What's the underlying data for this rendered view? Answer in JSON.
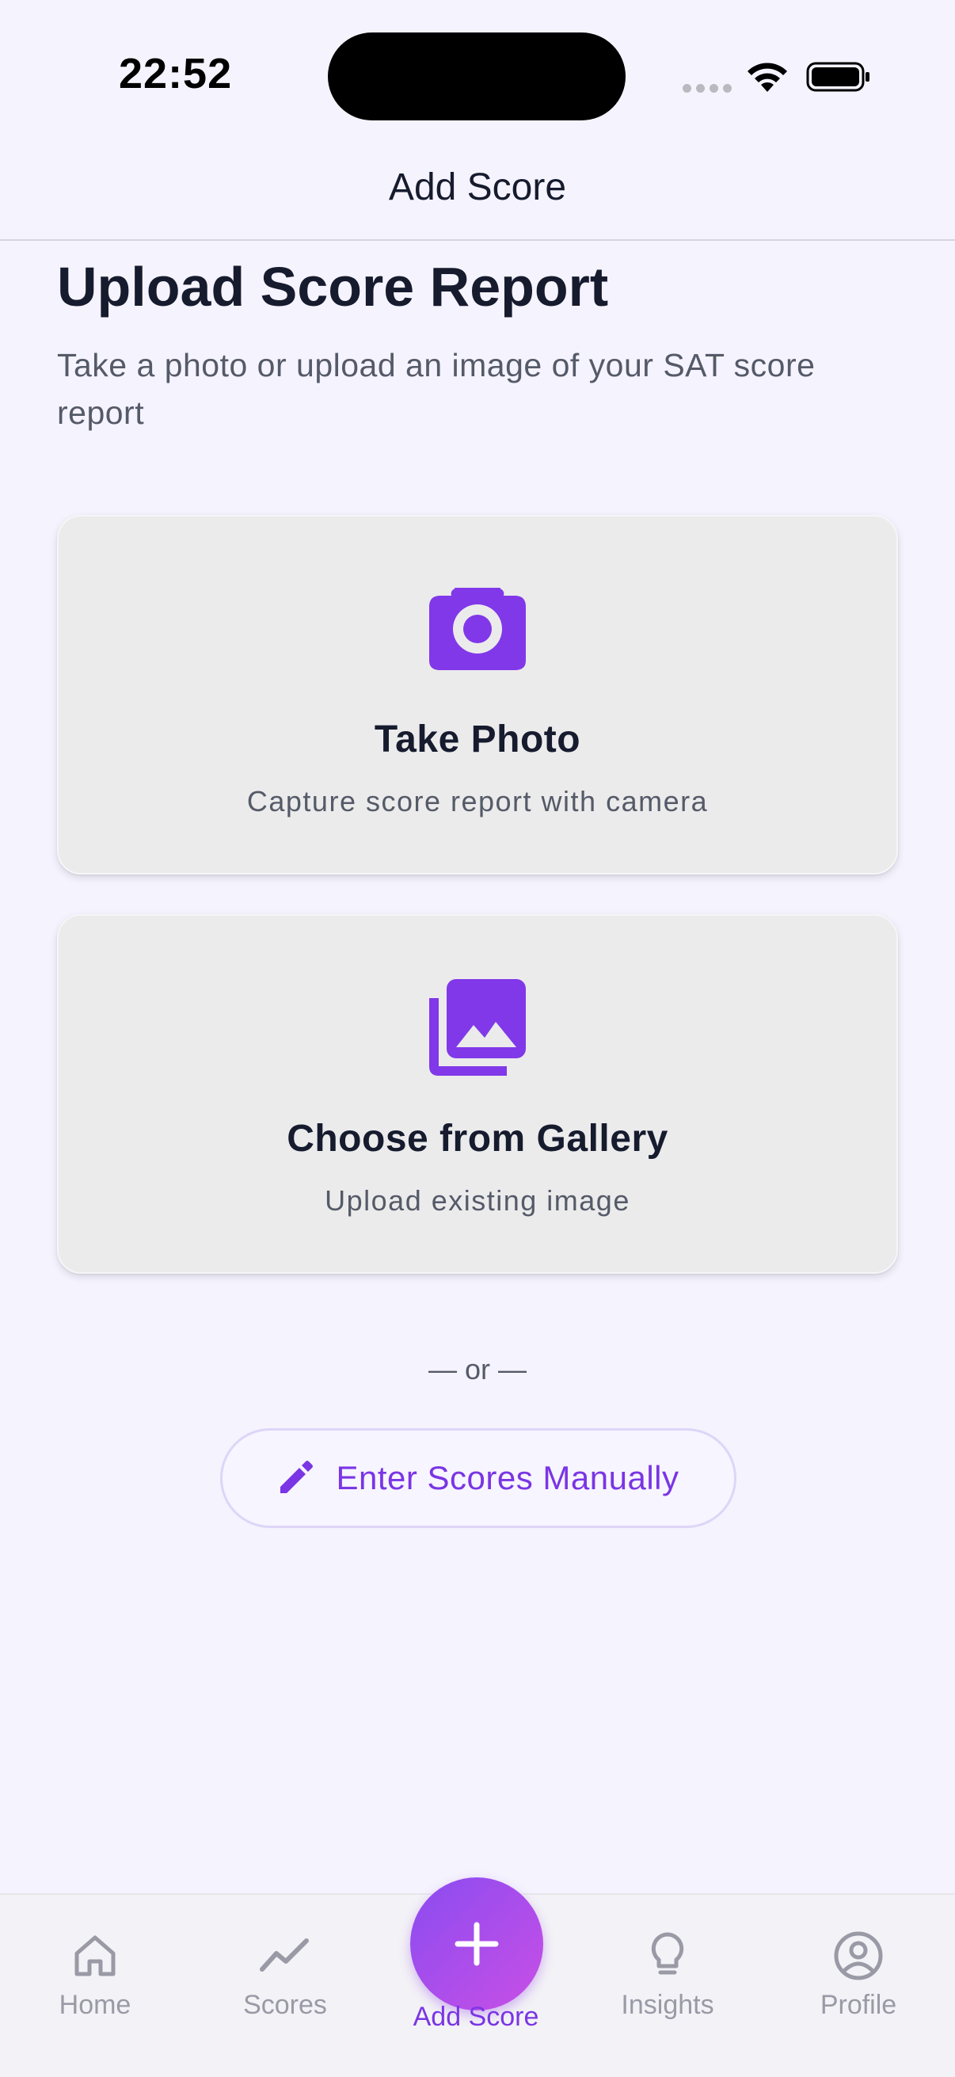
{
  "status_bar": {
    "time": "22:52",
    "icons": [
      "signal-dots-icon",
      "wifi-icon",
      "battery-icon"
    ]
  },
  "nav": {
    "title": "Add Score"
  },
  "main": {
    "heading": "Upload Score Report",
    "subtitle": "Take a photo or upload an image of your SAT score report",
    "options": [
      {
        "icon": "camera-icon",
        "title": "Take Photo",
        "subtitle": "Capture score report with camera"
      },
      {
        "icon": "gallery-icon",
        "title": "Choose from Gallery",
        "subtitle": "Upload existing image"
      }
    ],
    "divider": "— or —",
    "manual_button": {
      "icon": "pencil-icon",
      "label": "Enter Scores Manually"
    }
  },
  "tab_bar": {
    "tabs": [
      {
        "label": "Home",
        "icon": "home-icon"
      },
      {
        "label": "Scores",
        "icon": "trend-icon"
      },
      {
        "label": "Add Score",
        "icon": "plus-icon",
        "active": true
      },
      {
        "label": "Insights",
        "icon": "lightbulb-icon"
      },
      {
        "label": "Profile",
        "icon": "profile-icon"
      }
    ]
  },
  "colors": {
    "accent": "#7a35e4",
    "fab_gradient_start": "#8a4cf0",
    "fab_gradient_end": "#c94fe6",
    "background": "#f5f3fe",
    "card": "#ebebec",
    "inactive_tab": "#9a9aa6"
  }
}
